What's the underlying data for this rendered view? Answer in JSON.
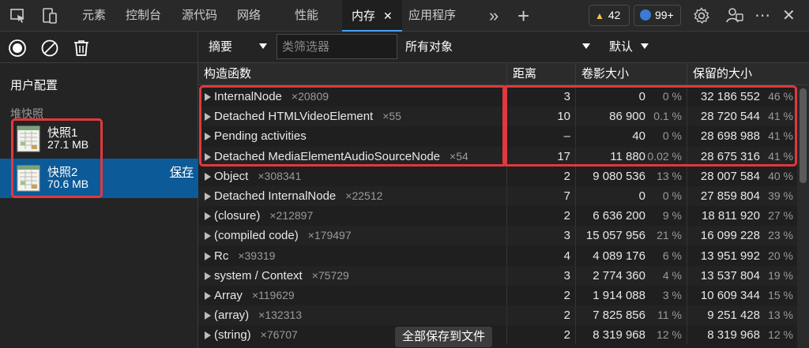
{
  "tabs": [
    "元素",
    "控制台",
    "源代码",
    "网络",
    "性能",
    "内存",
    "应用程序"
  ],
  "active_tab": "内存",
  "close_glyph": "✕",
  "more_tabs_glyph": "»",
  "add_tab_glyph": "+",
  "status": {
    "warnings": "42",
    "messages": "99+"
  },
  "window_controls": {
    "more": "⋯",
    "close": "✕"
  },
  "left": {
    "profiles_title": "用户配置",
    "heap_snapshots_title": "堆快照",
    "snapshots": [
      {
        "name": "快照1",
        "size": "27.1 MB"
      },
      {
        "name": "快照2",
        "size": "70.6 MB",
        "save": "保存"
      }
    ]
  },
  "filter": {
    "summary": "摘要",
    "class_filter_placeholder": "类筛选器",
    "objects": "所有对象",
    "default": "默认"
  },
  "columns": {
    "constructor": "构造函数",
    "distance": "距离",
    "shallow": "卷影大小",
    "retained": "保留的大小"
  },
  "rows": [
    {
      "name": "InternalNode",
      "count": "×20809",
      "distance": "3",
      "shallow": "0",
      "shallow_pct": "0 %",
      "retained": "32 186 552",
      "retained_pct": "46 %"
    },
    {
      "name": "Detached HTMLVideoElement",
      "count": "×55",
      "distance": "10",
      "shallow": "86 900",
      "shallow_pct": "0.1 %",
      "retained": "28 720 544",
      "retained_pct": "41 %"
    },
    {
      "name": "Pending activities",
      "count": "",
      "distance": "–",
      "shallow": "40",
      "shallow_pct": "0 %",
      "retained": "28 698 988",
      "retained_pct": "41 %"
    },
    {
      "name": "Detached MediaElementAudioSourceNode",
      "count": "×54",
      "distance": "17",
      "shallow": "11 880",
      "shallow_pct": "0.02 %",
      "retained": "28 675 316",
      "retained_pct": "41 %"
    },
    {
      "name": "Object",
      "count": "×308341",
      "distance": "2",
      "shallow": "9 080 536",
      "shallow_pct": "13 %",
      "retained": "28 007 584",
      "retained_pct": "40 %"
    },
    {
      "name": "Detached InternalNode",
      "count": "×22512",
      "distance": "7",
      "shallow": "0",
      "shallow_pct": "0 %",
      "retained": "27 859 804",
      "retained_pct": "39 %"
    },
    {
      "name": "(closure)",
      "count": "×212897",
      "distance": "2",
      "shallow": "6 636 200",
      "shallow_pct": "9 %",
      "retained": "18 811 920",
      "retained_pct": "27 %"
    },
    {
      "name": "(compiled code)",
      "count": "×179497",
      "distance": "3",
      "shallow": "15 057 956",
      "shallow_pct": "21 %",
      "retained": "16 099 228",
      "retained_pct": "23 %"
    },
    {
      "name": "Rc",
      "count": "×39319",
      "distance": "4",
      "shallow": "4 089 176",
      "shallow_pct": "6 %",
      "retained": "13 951 992",
      "retained_pct": "20 %"
    },
    {
      "name": "system / Context",
      "count": "×75729",
      "distance": "3",
      "shallow": "2 774 360",
      "shallow_pct": "4 %",
      "retained": "13 537 804",
      "retained_pct": "19 %"
    },
    {
      "name": "Array",
      "count": "×119629",
      "distance": "2",
      "shallow": "1 914 088",
      "shallow_pct": "3 %",
      "retained": "10 609 344",
      "retained_pct": "15 %"
    },
    {
      "name": "(array)",
      "count": "×132313",
      "distance": "2",
      "shallow": "7 825 856",
      "shallow_pct": "11 %",
      "retained": "9 251 428",
      "retained_pct": "13 %"
    },
    {
      "name": "(string)",
      "count": "×76707",
      "distance": "2",
      "shallow": "8 319 968",
      "shallow_pct": "12 %",
      "retained": "8 319 968",
      "retained_pct": "12 %"
    }
  ],
  "save_all": "全部保存到文件",
  "colors": {
    "accent": "#4aa3f5",
    "selected": "#0c5a97",
    "highlight": "#e0393e",
    "warning": "#f2c744"
  }
}
